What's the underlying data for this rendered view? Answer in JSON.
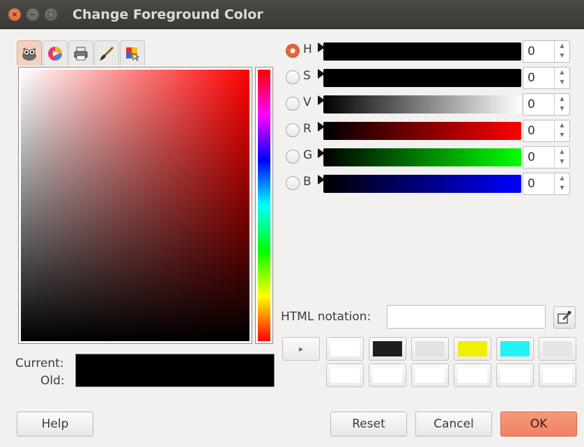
{
  "window": {
    "title": "Change Foreground Color",
    "close_glyph": "×",
    "min_glyph": "−",
    "max_glyph": "□"
  },
  "tabs": [
    {
      "icon": "gimp-wilber-icon",
      "active": true
    },
    {
      "icon": "color-wheel-icon",
      "active": false
    },
    {
      "icon": "printer-icon",
      "active": false
    },
    {
      "icon": "paintbrush-icon",
      "active": false
    },
    {
      "icon": "palette-icon",
      "active": false
    }
  ],
  "labels": {
    "current": "Current:",
    "old": "Old:",
    "html_notation": "HTML notation:"
  },
  "channels": [
    {
      "key": "H",
      "value": "0",
      "selected": true
    },
    {
      "key": "S",
      "value": "0",
      "selected": false
    },
    {
      "key": "V",
      "value": "0",
      "selected": false
    },
    {
      "key": "R",
      "value": "0",
      "selected": false
    },
    {
      "key": "G",
      "value": "0",
      "selected": false
    },
    {
      "key": "B",
      "value": "0",
      "selected": false
    }
  ],
  "html_notation_value": "",
  "current_color": "#000000",
  "old_color": "#000000",
  "history_colors": [
    "#ffffff",
    "#1e1e1e",
    "#e2e2e2",
    "#eef000",
    "#22f2f4",
    "#e6e6e6",
    "#ffffff",
    "#ffffff",
    "#ffffff",
    "#ffffff",
    "#ffffff",
    "#ffffff"
  ],
  "buttons": {
    "help": "Help",
    "reset": "Reset",
    "cancel": "Cancel",
    "ok": "OK"
  },
  "history_toggle_glyph": "▸",
  "spin_up": "▲",
  "spin_down": "▼"
}
